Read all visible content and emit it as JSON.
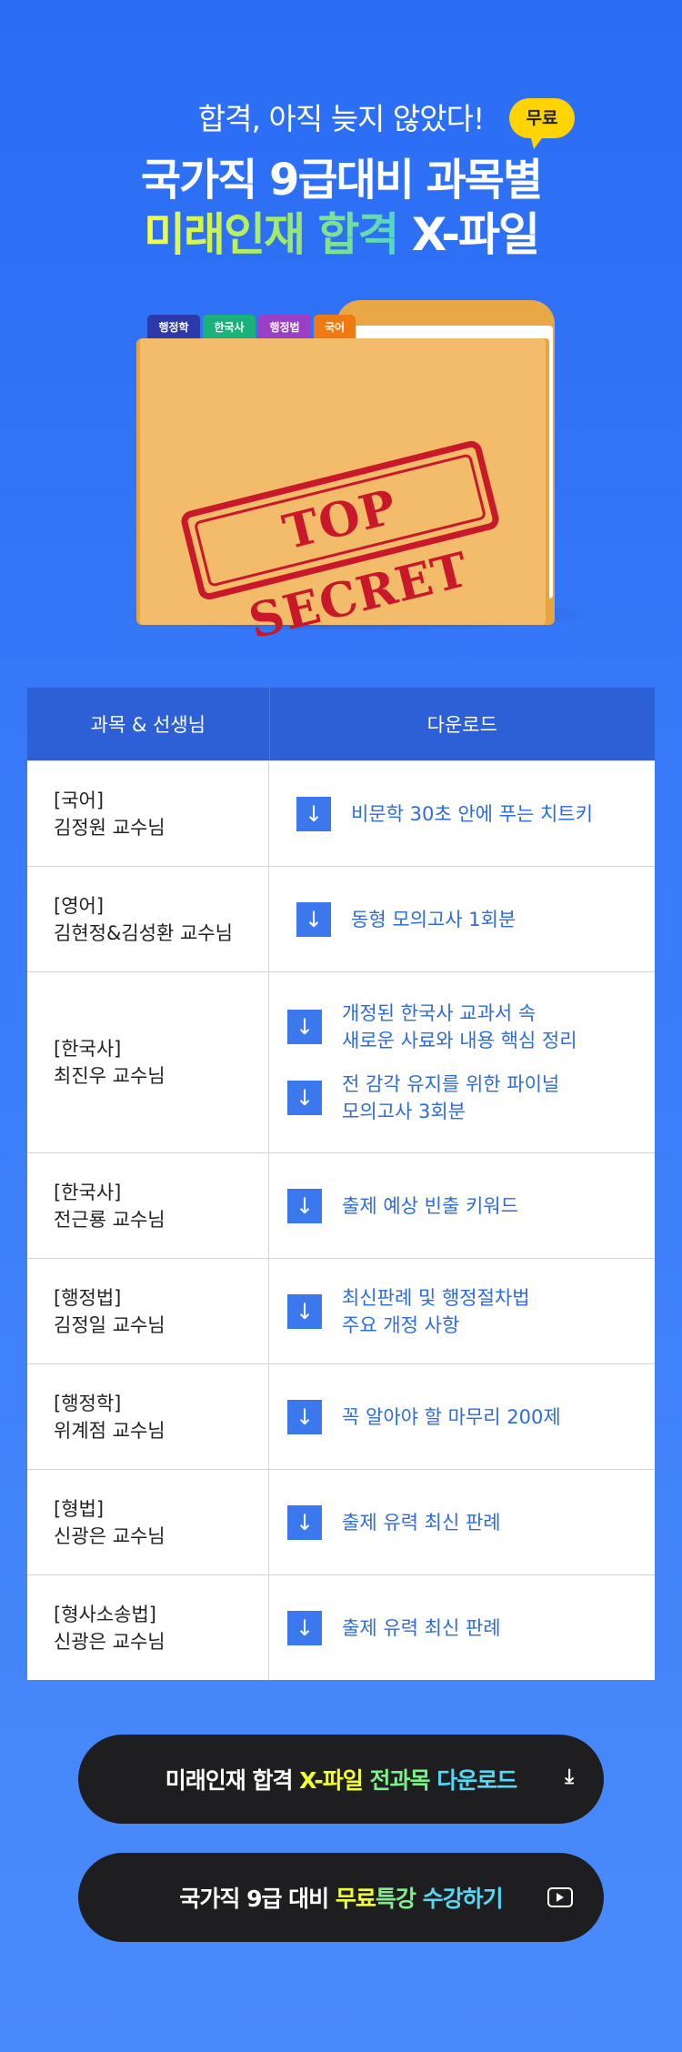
{
  "hero": {
    "subtitle": "합격, 아직 늦지 않았다!",
    "badge": "무료",
    "title_line1": "국가직 9급대비 과목별",
    "title_line2_gradient": "미래인재 합격",
    "title_line2_rest": " X-파일"
  },
  "folder": {
    "tabs": [
      {
        "label": "행정학",
        "color": "#2b3aa8"
      },
      {
        "label": "한국사",
        "color": "#1ab27a"
      },
      {
        "label": "행정법",
        "color": "#9b3fc4"
      },
      {
        "label": "국어",
        "color": "#f07a12"
      }
    ],
    "stamp": "TOP SECRET"
  },
  "table": {
    "header_subject": "과목 & 선생님",
    "header_download": "다운로드",
    "rows": [
      {
        "subject": "[국어]",
        "teacher": "김정원 교수님",
        "downloads": [
          "비문학 30초 안에 푸는 치트키"
        ]
      },
      {
        "subject": "[영어]",
        "teacher": "김현정&김성환 교수님",
        "downloads": [
          "동형 모의고사 1회분"
        ]
      },
      {
        "subject": "[한국사]",
        "teacher": "최진우 교수님",
        "downloads": [
          "개정된 한국사 교과서 속\n새로운 사료와 내용 핵심 정리",
          "전 감각 유지를 위한 파이널\n모의고사 3회분"
        ]
      },
      {
        "subject": "[한국사]",
        "teacher": "전근룡 교수님",
        "downloads": [
          "출제 예상 빈출 키워드"
        ]
      },
      {
        "subject": "[행정법]",
        "teacher": "김정일 교수님",
        "downloads": [
          "최신판례 및 행정절차법\n주요 개정 사항"
        ]
      },
      {
        "subject": "[행정학]",
        "teacher": "위계점 교수님",
        "downloads": [
          "꼭 알아야 할 마무리 200제"
        ]
      },
      {
        "subject": "[형법]",
        "teacher": "신광은 교수님",
        "downloads": [
          "출제 유력 최신 판례"
        ]
      },
      {
        "subject": "[형사소송법]",
        "teacher": "신광은 교수님",
        "downloads": [
          "출제 유력 최신 판례"
        ]
      }
    ]
  },
  "buttons": {
    "download_all": {
      "part1": "미래인재 합격 ",
      "part2": "X-파일 ",
      "part3": "전과목 ",
      "part4": "다운로드",
      "icon": "download-icon"
    },
    "free_lecture": {
      "part1": "국가직 9급 대비 ",
      "part2": "무료",
      "part3": "특강 ",
      "part4": "수강하기",
      "icon": "play-icon"
    }
  }
}
